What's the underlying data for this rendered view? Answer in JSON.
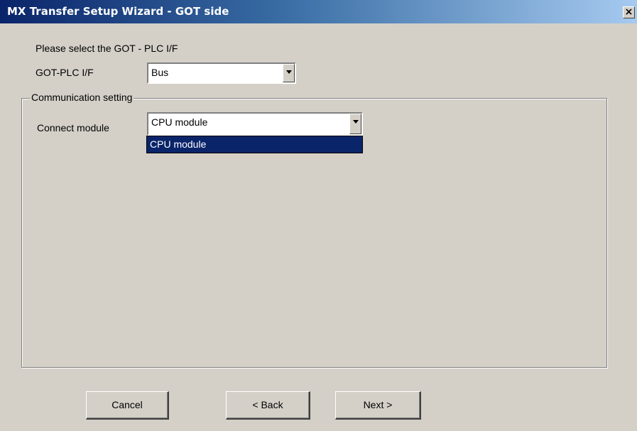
{
  "window": {
    "title": "MX Transfer Setup Wizard - GOT side",
    "close_label": "×"
  },
  "prompt": "Please select the GOT - PLC I/F",
  "got_plc_if": {
    "label": "GOT-PLC I/F",
    "value": "Bus"
  },
  "communication": {
    "group_label": "Communication setting",
    "connect_module_label": "Connect module",
    "connect_module_value": "CPU module",
    "options": [
      "CPU module"
    ]
  },
  "buttons": {
    "cancel": "Cancel",
    "back": "< Back",
    "next": "Next >"
  }
}
